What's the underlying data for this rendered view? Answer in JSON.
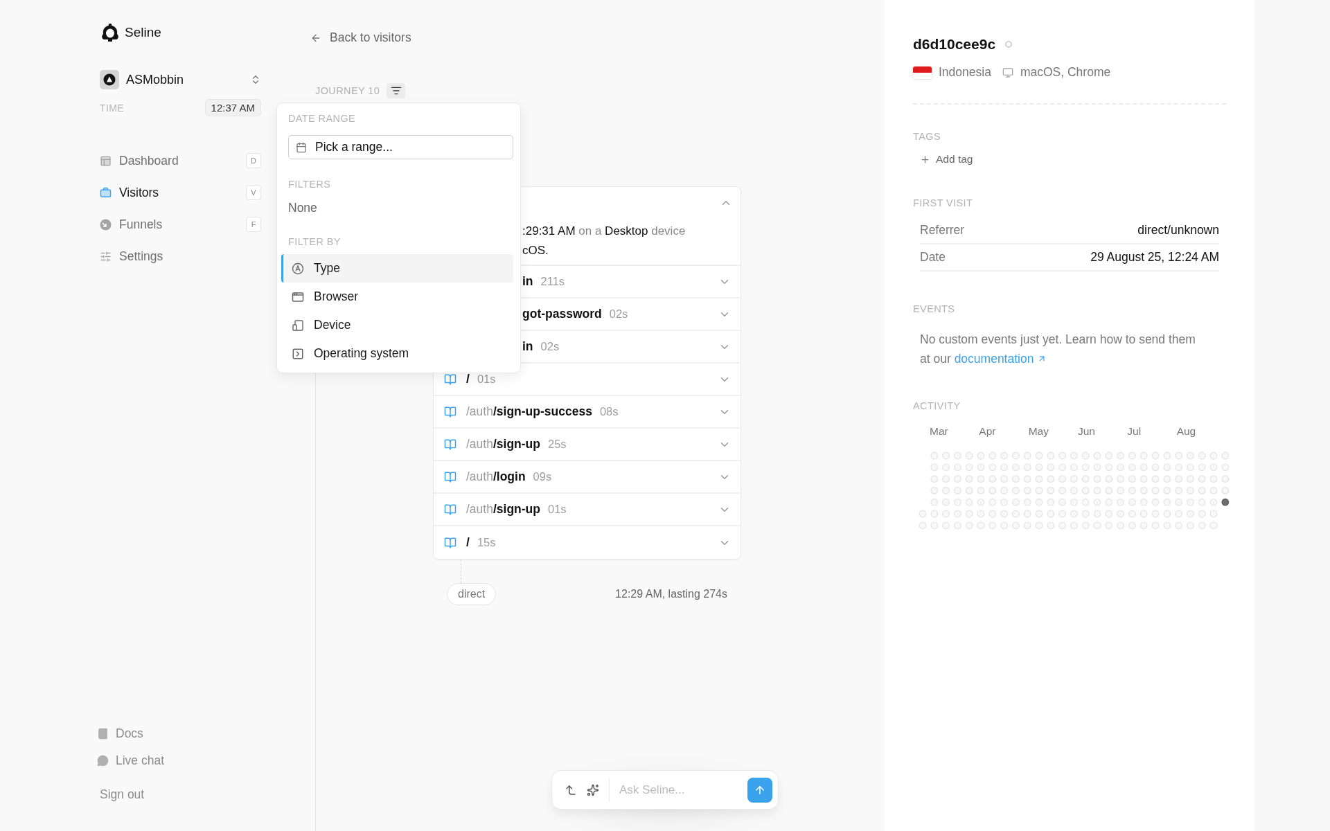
{
  "brand": {
    "name": "Seline"
  },
  "project": {
    "name": "ASMobbin"
  },
  "time": {
    "label": "TIME",
    "value": "12:37 AM"
  },
  "nav": [
    {
      "label": "Dashboard",
      "shortcut": "D",
      "selected": false
    },
    {
      "label": "Visitors",
      "shortcut": "V",
      "selected": true
    },
    {
      "label": "Funnels",
      "shortcut": "F",
      "selected": false
    },
    {
      "label": "Settings",
      "selected": false
    }
  ],
  "footer_links": [
    {
      "label": "Docs"
    },
    {
      "label": "Live chat"
    },
    {
      "label": "Sign out"
    }
  ],
  "back_link": "Back to visitors",
  "journey": {
    "title": "JOURNEY 10",
    "expanded": true,
    "header_lines": [
      [
        {
          "text": ":29:31 AM",
          "emphasis": true
        },
        {
          "text": " on a ",
          "emphasis": false
        },
        {
          "text": "Desktop",
          "emphasis": true
        },
        {
          "text": " device",
          "emphasis": false
        }
      ],
      [
        {
          "text": "cOS.",
          "emphasis": true
        }
      ]
    ],
    "rows": [
      {
        "path": "in",
        "duration": "211s",
        "clipped": true
      },
      {
        "path": "got-password",
        "duration": "02s",
        "clipped": true
      },
      {
        "path": "in",
        "duration": "02s",
        "clipped": true
      },
      {
        "path": "/",
        "duration": "01s",
        "clipped": false
      },
      {
        "prefix": "/auth",
        "path": "/sign-up-success",
        "duration": "08s",
        "clipped": false
      },
      {
        "prefix": "/auth",
        "path": "/sign-up",
        "duration": "25s",
        "clipped": false
      },
      {
        "prefix": "/auth",
        "path": "/login",
        "duration": "09s",
        "clipped": false
      },
      {
        "prefix": "/auth",
        "path": "/sign-up",
        "duration": "01s",
        "clipped": false
      },
      {
        "path": "/",
        "duration": "15s",
        "clipped": false
      }
    ],
    "source": "direct",
    "summary": "12:29 AM, lasting 274s"
  },
  "filter_popover": {
    "date_range_label": "DATE RANGE",
    "date_placeholder": "Pick a range...",
    "filters_label": "FILTERS",
    "filters_value": "None",
    "filter_by_label": "FILTER BY",
    "options": [
      {
        "label": "Type",
        "selected": true
      },
      {
        "label": "Browser",
        "selected": false
      },
      {
        "label": "Device",
        "selected": false
      },
      {
        "label": "Operating system",
        "selected": false
      }
    ]
  },
  "chat": {
    "placeholder": "Ask Seline..."
  },
  "visitor": {
    "id": "d6d10cee9c",
    "online": false,
    "country": "Indonesia",
    "system": "macOS, Chrome",
    "tags_label": "TAGS",
    "add_tag": "Add tag",
    "first_visit_label": "FIRST VISIT",
    "first_visit": [
      {
        "label": "Referrer",
        "value": "direct/unknown"
      },
      {
        "label": "Date",
        "value": "29 August 25, 12:24 AM"
      }
    ],
    "events_label": "EVENTS",
    "events_text": "No custom events just yet. Learn how to send them at our",
    "events_link": "documentation",
    "activity_label": "ACTIVITY",
    "months": [
      "Mar",
      "Apr",
      "May",
      "Jun",
      "Jul",
      "Aug"
    ]
  }
}
